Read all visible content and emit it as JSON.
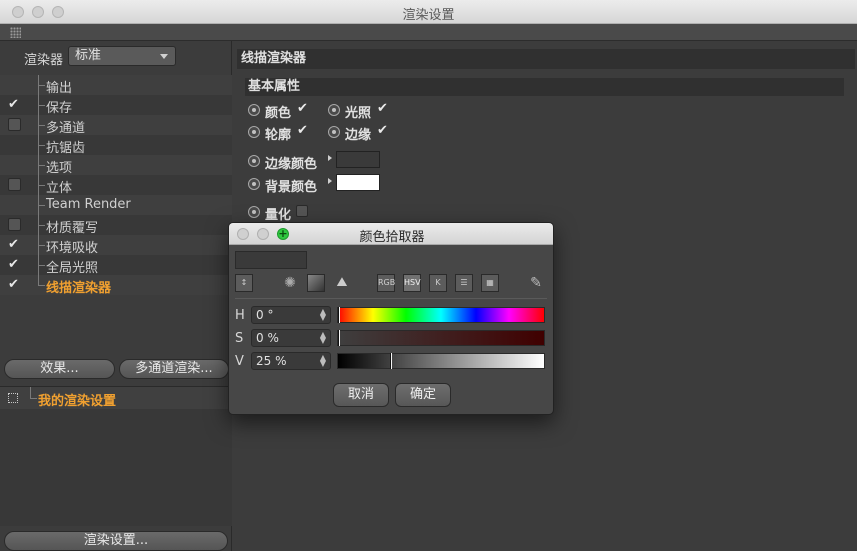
{
  "window": {
    "title": "渲染设置"
  },
  "left": {
    "renderer_label": "渲染器",
    "renderer_value": "标准",
    "items": [
      {
        "label": "输出",
        "check": "none"
      },
      {
        "label": "保存",
        "check": "checked"
      },
      {
        "label": "多通道",
        "check": "box"
      },
      {
        "label": "抗锯齿",
        "check": "none"
      },
      {
        "label": "选项",
        "check": "none"
      },
      {
        "label": "立体",
        "check": "box"
      },
      {
        "label": "Team Render",
        "check": "none"
      },
      {
        "label": "材质覆写",
        "check": "box"
      },
      {
        "label": "环境吸收",
        "check": "checked"
      },
      {
        "label": "全局光照",
        "check": "checked"
      },
      {
        "label": "线描渲染器",
        "check": "checked",
        "active": true
      }
    ],
    "effects_button": "效果...",
    "multipass_button": "多通道渲染...",
    "preset_label": "我的渲染设置",
    "render_settings_button": "渲染设置..."
  },
  "right": {
    "title": "线描渲染器",
    "group": "基本属性",
    "check_mark": "✔",
    "params": {
      "color": "颜色",
      "lighting": "光照",
      "outline": "轮廓",
      "edge": "边缘",
      "edge_color": "边缘颜色",
      "background_color": "背景颜色",
      "quantize": "量化"
    },
    "colors": {
      "edge_color": "#3a3a3a",
      "background_color": "#ffffff"
    }
  },
  "picker": {
    "title": "颜色拾取器",
    "tools": [
      "RGB",
      "HSV",
      "K"
    ],
    "h_label": "H",
    "h_value": "0 °",
    "s_label": "S",
    "s_value": "0 %",
    "v_label": "V",
    "v_value": "25 %",
    "h_fraction": 0.0,
    "s_fraction": 0.0,
    "v_fraction": 0.25,
    "cancel": "取消",
    "ok": "确定"
  }
}
